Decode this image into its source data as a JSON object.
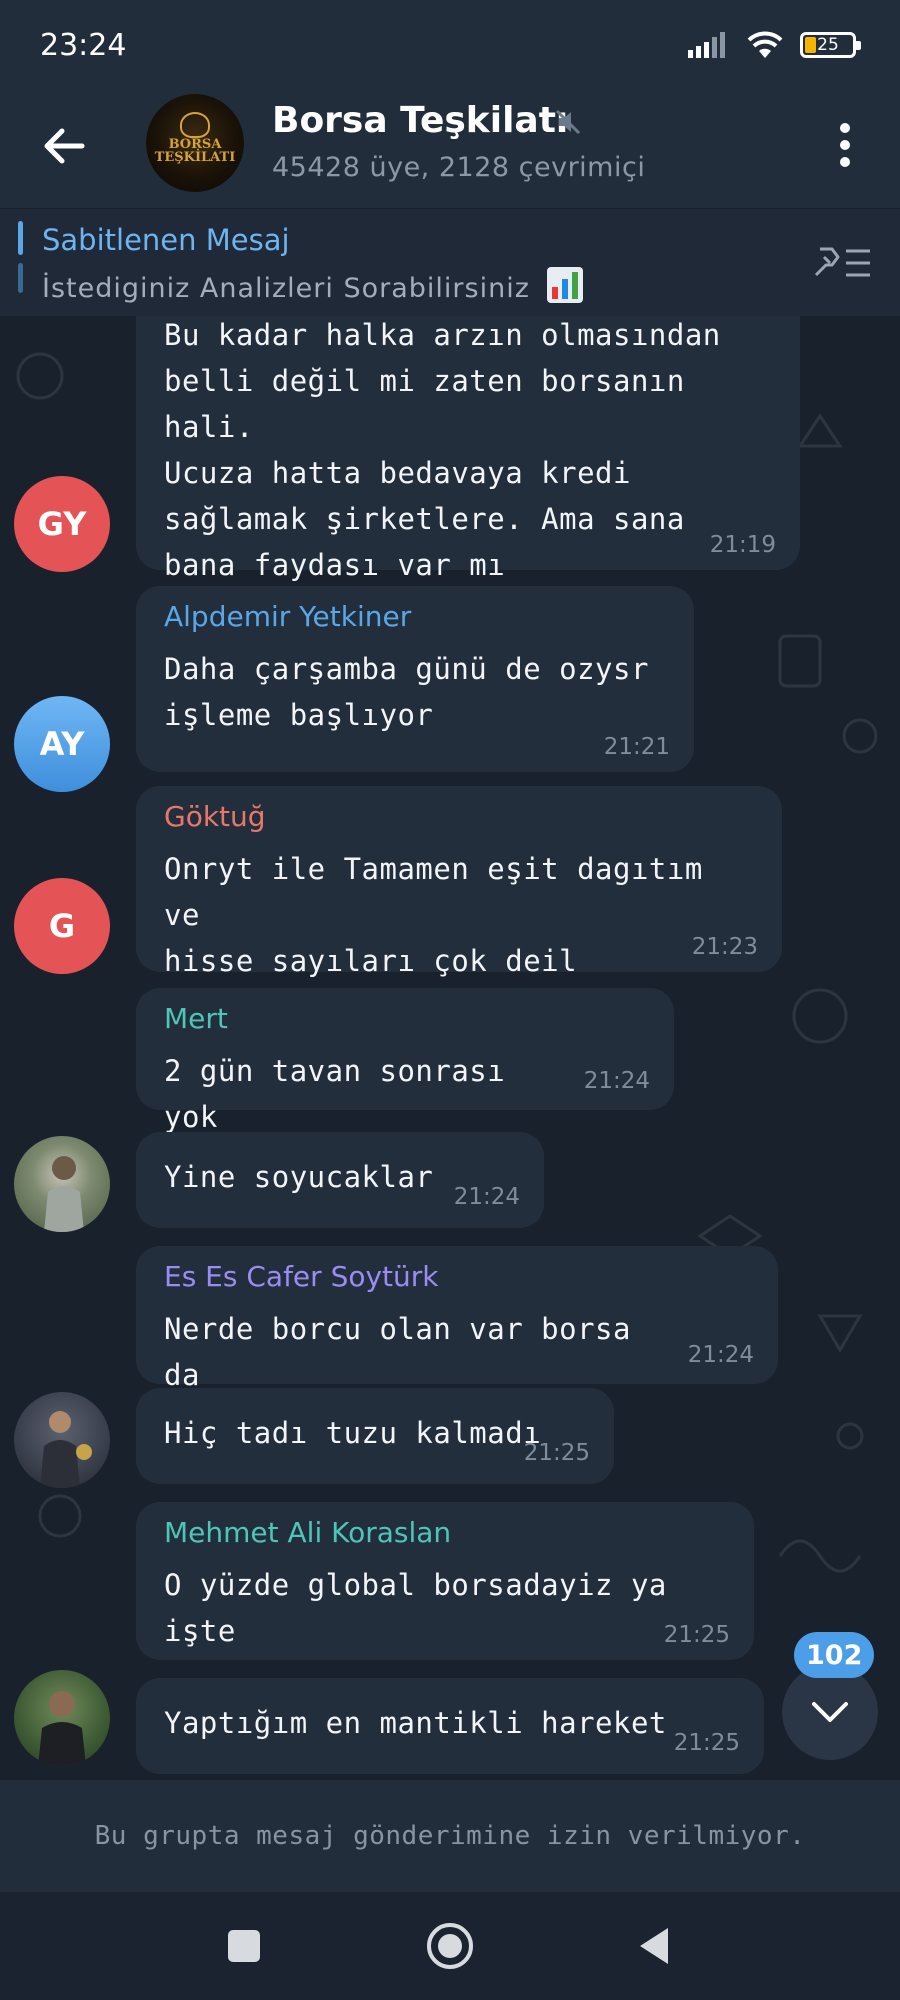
{
  "status_bar": {
    "time": "23:24",
    "battery": "25",
    "icons": [
      "signal-icon",
      "wifi-icon",
      "battery-icon"
    ]
  },
  "header": {
    "title": "Borsa Teşkilatı",
    "subtitle": "45428 üye, 2128 çevrimiçi",
    "avatar_logo": "BORSA TEŞKİLATI"
  },
  "pinned": {
    "title": "Sabitlenen Mesaj",
    "text": "İstediginiz Analizleri Sorabilirsiniz"
  },
  "messages": [
    {
      "sender": "",
      "avatar": "GY",
      "text": "Bu kadar halka arzın olmasından\nbelli değil mi zaten borsanın hali.\nUcuza hatta bedavaya kredi\nsağlamak şirketlere. Ama sana\nbana faydası var mı",
      "time": "21:19"
    },
    {
      "sender": "Alpdemir Yetkiner",
      "avatar": "AY",
      "text": "Daha çarşamba günü de ozysr\nişleme başlıyor",
      "time": "21:21"
    },
    {
      "sender": "Göktuğ",
      "avatar": "G",
      "text": "Onryt ile Tamamen eşit dagıtım ve\nhisse sayıları çok deil",
      "time": "21:23"
    },
    {
      "sender": "Mert",
      "avatar": "",
      "text": "2 gün tavan sonrası yok",
      "time": "21:24"
    },
    {
      "sender": "",
      "avatar": "",
      "text": "Yine soyucaklar",
      "time": "21:24"
    },
    {
      "sender": "Es Es Cafer Soytürk",
      "avatar": "",
      "text": "Nerde borcu olan var borsa da",
      "time": "21:24"
    },
    {
      "sender": "",
      "avatar": "",
      "text": "Hiç tadı tuzu kalmadı",
      "time": "21:25"
    },
    {
      "sender": "Mehmet Ali Koraslan",
      "avatar": "",
      "text": "O yüzde global borsadayiz ya işte",
      "time": "21:25"
    },
    {
      "sender": "",
      "avatar": "",
      "text": "Yaptığım en mantikli hareket",
      "time": "21:25"
    }
  ],
  "colors": {
    "alpdemir": "#5aa6e6",
    "goktug": "#e8776b",
    "mert": "#4fc4b8",
    "cafer": "#9a8cf2",
    "mehmet": "#4fc4b8"
  },
  "scroll": {
    "unread_count": "102"
  },
  "composer": {
    "note": "Bu grupta mesaj gönderimine izin verilmiyor."
  }
}
